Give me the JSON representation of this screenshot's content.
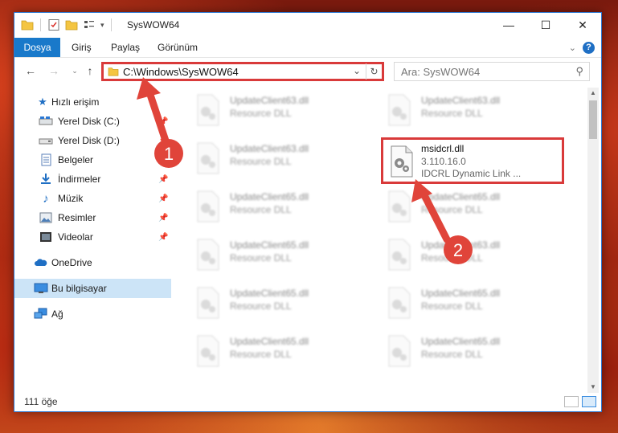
{
  "window": {
    "title": "SysWOW64",
    "controls": {
      "minimize": "—",
      "maximize": "☐",
      "close": "✕"
    }
  },
  "ribbon": {
    "tabs": [
      "Dosya",
      "Giriş",
      "Paylaş",
      "Görünüm"
    ],
    "help": "?"
  },
  "address": {
    "path": "C:\\Windows\\SysWOW64",
    "search_placeholder": "Ara: SysWOW64"
  },
  "nav": {
    "items": [
      {
        "label": "Hızlı erişim",
        "icon": "star-icon"
      },
      {
        "label": "Yerel Disk (C:)",
        "icon": "drive-icon"
      },
      {
        "label": "Yerel Disk (D:)",
        "icon": "drive-icon"
      },
      {
        "label": "Belgeler",
        "icon": "documents-icon"
      },
      {
        "label": "İndirmeler",
        "icon": "downloads-icon"
      },
      {
        "label": "Müzik",
        "icon": "music-icon"
      },
      {
        "label": "Resimler",
        "icon": "pictures-icon"
      },
      {
        "label": "Videolar",
        "icon": "videos-icon"
      },
      {
        "label": "OneDrive",
        "icon": "cloud-icon"
      },
      {
        "label": "Bu bilgisayar",
        "icon": "computer-icon"
      },
      {
        "label": "Ağ",
        "icon": "network-icon"
      }
    ]
  },
  "files": [
    {
      "name": "UpdateClient63.dll",
      "desc": "Resource DLL"
    },
    {
      "name": "UpdateClient63.dll",
      "desc": "Resource DLL"
    },
    {
      "name": "UpdateClient63.dll",
      "desc": "Resource DLL"
    },
    {
      "name": "msidcrl.dll",
      "version": "3.110.16.0",
      "desc": "IDCRL Dynamic Link ..."
    },
    {
      "name": "UpdateClient65.dll",
      "desc": "Resource DLL"
    },
    {
      "name": "UpdateClient65.dll",
      "desc": "Resource DLL"
    },
    {
      "name": "UpdateClient65.dll",
      "desc": "Resource DLL"
    },
    {
      "name": "UpdateClient63.dll",
      "desc": "Resource DLL"
    },
    {
      "name": "UpdateClient65.dll",
      "desc": "Resource DLL"
    },
    {
      "name": "UpdateClient65.dll",
      "desc": "Resource DLL"
    },
    {
      "name": "UpdateClient65.dll",
      "desc": "Resource DLL"
    },
    {
      "name": "UpdateClient65.dll",
      "desc": "Resource DLL"
    }
  ],
  "status": {
    "count": "111 öğe"
  },
  "annotations": {
    "badge1": "1",
    "badge2": "2"
  },
  "colors": {
    "accent": "#1979ca",
    "highlight": "#d93a3a",
    "badge": "#e0443a"
  }
}
